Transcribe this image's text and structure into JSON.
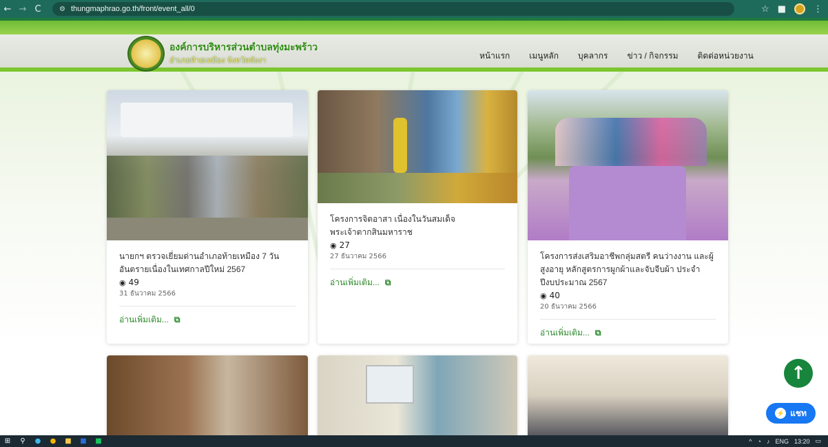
{
  "browser": {
    "url": "thungmaphrao.go.th/front/event_all/0",
    "back_icon": "arrow-left-icon",
    "forward_icon": "arrow-right-icon",
    "reload_icon": "reload-icon"
  },
  "header": {
    "org_name": "องค์การบริหารส่วนตำบลทุ่งมะพร้าว",
    "org_sub": "อำเภอท้ายเหมือง จังหวัดพังงา",
    "menu": [
      "หน้าแรก",
      "เมนูหลัก",
      "บุคลากร",
      "ข่าว / กิจกรรม",
      "ติดต่อหน่วยงาน"
    ]
  },
  "cards": [
    {
      "title": "นายกฯ ตรวจเยี่ยมด่านอำเภอท้ายเหมือง 7 วัน อันตรายเนื่องในเทศกาลปีใหม่ 2567",
      "views": "49",
      "date": "31 ธันวาคม 2566",
      "read_more": "อ่านเพิ่มเติม..."
    },
    {
      "title": "โครงการจิตอาสา เนื่องในวันสมเด็จพระเจ้าตากสินมหาราช",
      "views": "27",
      "date": "27 ธันวาคม 2566",
      "read_more": "อ่านเพิ่มเติม..."
    },
    {
      "title": "โครงการส่งเสริมอาชีพกลุ่มสตรี คนว่างงาน และผู้สูงอายุ หลักสูตรการผูกผ้าและจับจีบผ้า ประจำปีงบประมาณ 2567",
      "views": "40",
      "date": "20 ธันวาคม 2566",
      "read_more": "อ่านเพิ่มเติม..."
    }
  ],
  "floating": {
    "chat_label": "แชท"
  },
  "taskbar": {
    "lang": "ENG",
    "time": "13:20"
  },
  "colors": {
    "chrome": "#1f6b5b",
    "accent_green": "#2c8a2c",
    "scroll_top": "#17853b",
    "chat": "#1877f2"
  }
}
